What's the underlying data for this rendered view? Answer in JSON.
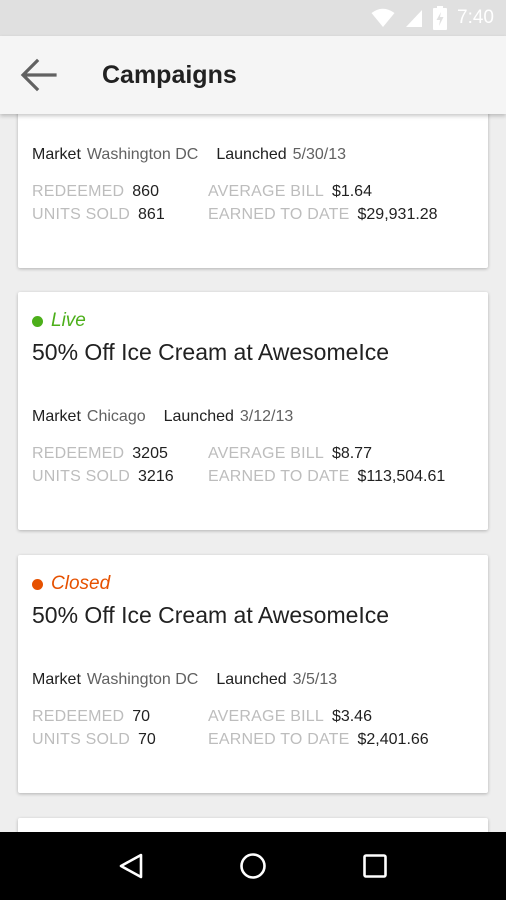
{
  "status_bar": {
    "time": "7:40",
    "icons": [
      "wifi-icon",
      "signal-icon",
      "battery-charging-icon"
    ]
  },
  "app_bar": {
    "title": "Campaigns",
    "back_icon": "arrow-left-icon"
  },
  "colors": {
    "live": "#4caf1a",
    "closed": "#e65100"
  },
  "cards": [
    {
      "market_label": "Market",
      "market": "Washington DC",
      "launched_label": "Launched",
      "launched": "5/30/13",
      "redeemed_label": "REDEEMED",
      "redeemed": "860",
      "units_sold_label": "UNITS SOLD",
      "units_sold": "861",
      "avg_bill_label": "AVERAGE BILL",
      "avg_bill": "$1.64",
      "earned_label": "EARNED TO DATE",
      "earned": "$29,931.28"
    },
    {
      "status": "Live",
      "title": "50% Off Ice Cream at AwesomeIce",
      "market_label": "Market",
      "market": "Chicago",
      "launched_label": "Launched",
      "launched": "3/12/13",
      "redeemed_label": "REDEEMED",
      "redeemed": "3205",
      "units_sold_label": "UNITS SOLD",
      "units_sold": "3216",
      "avg_bill_label": "AVERAGE BILL",
      "avg_bill": "$8.77",
      "earned_label": "EARNED TO DATE",
      "earned": "$113,504.61"
    },
    {
      "status": "Closed",
      "title": "50% Off Ice Cream at AwesomeIce",
      "market_label": "Market",
      "market": "Washington DC",
      "launched_label": "Launched",
      "launched": "3/5/13",
      "redeemed_label": "REDEEMED",
      "redeemed": "70",
      "units_sold_label": "UNITS SOLD",
      "units_sold": "70",
      "avg_bill_label": "AVERAGE BILL",
      "avg_bill": "$3.46",
      "earned_label": "EARNED TO DATE",
      "earned": "$2,401.66"
    }
  ],
  "nav_bar": {
    "icons": [
      "back-triangle-icon",
      "home-circle-icon",
      "recents-square-icon"
    ]
  }
}
